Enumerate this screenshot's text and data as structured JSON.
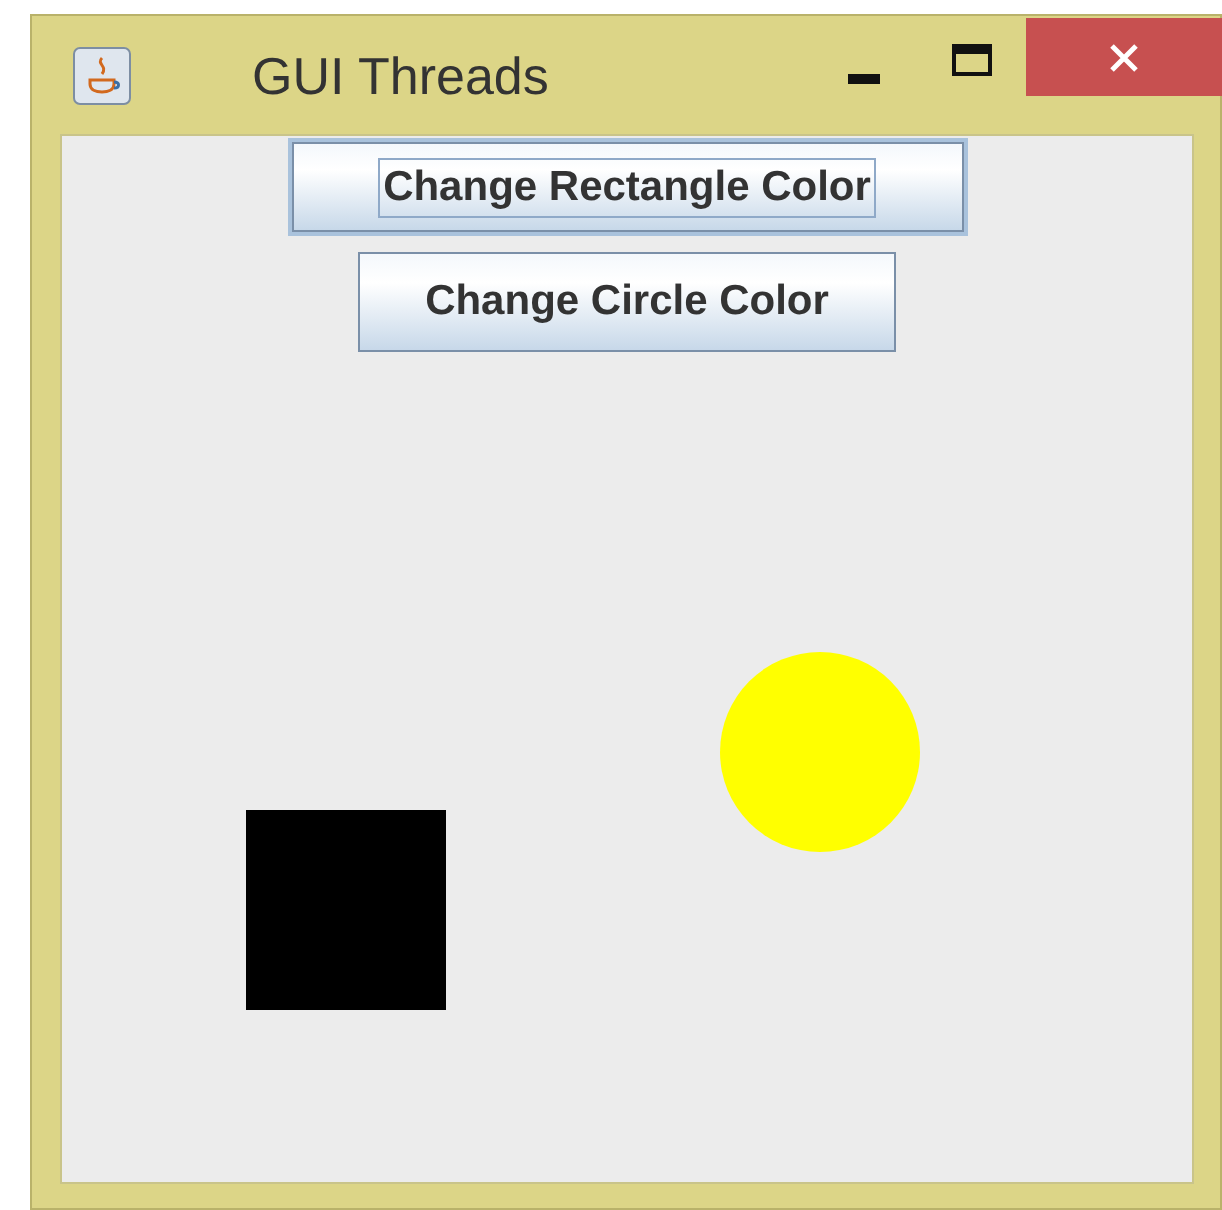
{
  "window": {
    "title": "GUI Threads"
  },
  "buttons": [
    {
      "label": "Change Rectangle Color",
      "focused": true
    },
    {
      "label": "Change Circle Color",
      "focused": false
    }
  ],
  "shapes": [
    {
      "kind": "circle",
      "color": "#ffff00"
    },
    {
      "kind": "square",
      "color": "#000000"
    }
  ]
}
